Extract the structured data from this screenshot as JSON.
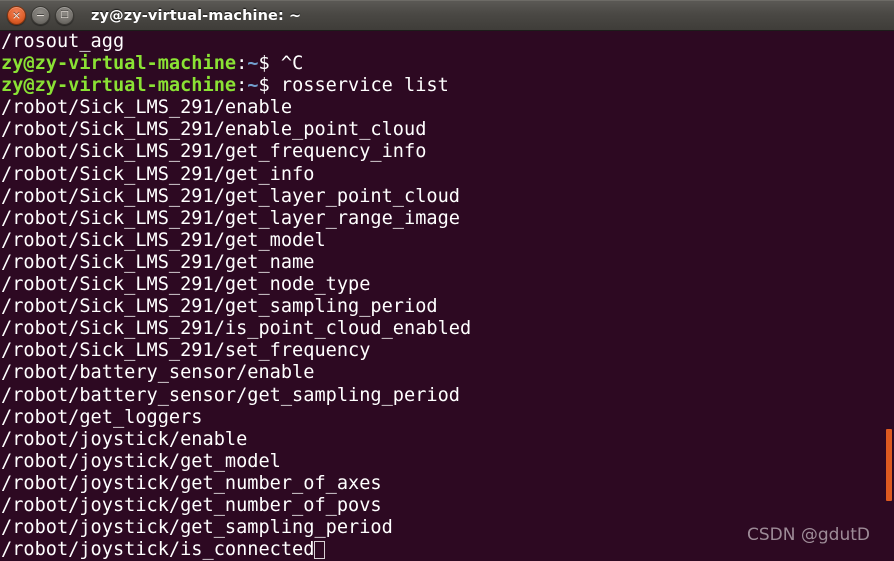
{
  "window": {
    "title": "zy@zy-virtual-machine: ~",
    "controls": [
      {
        "name": "close",
        "glyph": "×"
      },
      {
        "name": "minimize",
        "glyph": "−"
      },
      {
        "name": "maximize",
        "glyph": "□"
      }
    ]
  },
  "colors": {
    "background": "#2d0922",
    "foreground": "#ffffff",
    "prompt_user": "#8ae234",
    "prompt_path": "#729fcf",
    "titlebar": "#4a4844",
    "scrollbar_thumb": "#dd5a20",
    "close_button": "#e2622d",
    "watermark": "#b6a8b1"
  },
  "terminal": {
    "prompt": {
      "user_host": "zy@zy-virtual-machine",
      "separator": ":",
      "path": "~",
      "symbol": "$"
    },
    "lines": [
      {
        "type": "output",
        "text": "/rosout_agg"
      },
      {
        "type": "prompt",
        "command": "^C"
      },
      {
        "type": "prompt",
        "command": "rosservice list"
      },
      {
        "type": "output",
        "text": "/robot/Sick_LMS_291/enable"
      },
      {
        "type": "output",
        "text": "/robot/Sick_LMS_291/enable_point_cloud"
      },
      {
        "type": "output",
        "text": "/robot/Sick_LMS_291/get_frequency_info"
      },
      {
        "type": "output",
        "text": "/robot/Sick_LMS_291/get_info"
      },
      {
        "type": "output",
        "text": "/robot/Sick_LMS_291/get_layer_point_cloud"
      },
      {
        "type": "output",
        "text": "/robot/Sick_LMS_291/get_layer_range_image"
      },
      {
        "type": "output",
        "text": "/robot/Sick_LMS_291/get_model"
      },
      {
        "type": "output",
        "text": "/robot/Sick_LMS_291/get_name"
      },
      {
        "type": "output",
        "text": "/robot/Sick_LMS_291/get_node_type"
      },
      {
        "type": "output",
        "text": "/robot/Sick_LMS_291/get_sampling_period"
      },
      {
        "type": "output",
        "text": "/robot/Sick_LMS_291/is_point_cloud_enabled"
      },
      {
        "type": "output",
        "text": "/robot/Sick_LMS_291/set_frequency"
      },
      {
        "type": "output",
        "text": "/robot/battery_sensor/enable"
      },
      {
        "type": "output",
        "text": "/robot/battery_sensor/get_sampling_period"
      },
      {
        "type": "output",
        "text": "/robot/get_loggers"
      },
      {
        "type": "output",
        "text": "/robot/joystick/enable"
      },
      {
        "type": "output",
        "text": "/robot/joystick/get_model"
      },
      {
        "type": "output",
        "text": "/robot/joystick/get_number_of_axes"
      },
      {
        "type": "output",
        "text": "/robot/joystick/get_number_of_povs"
      },
      {
        "type": "output",
        "text": "/robot/joystick/get_sampling_period"
      },
      {
        "type": "output",
        "text": "/robot/joystick/is_connected",
        "cursor": true
      }
    ]
  },
  "watermark": {
    "text": "CSDN @gdutD"
  }
}
